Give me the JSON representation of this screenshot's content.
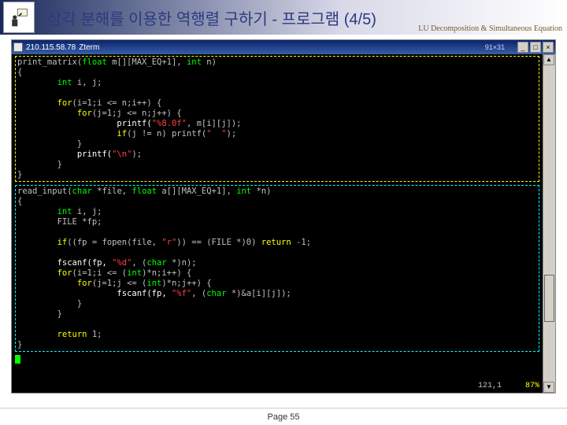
{
  "header": {
    "title": "삼각 분해를 이용한 역행렬 구하기 - 프로그램 (4/5)",
    "subtitle": "LU Decomposition & Simultaneous Equation"
  },
  "terminal": {
    "host": "210.115.58.78",
    "app": "Zterm",
    "dimensions": "91×31",
    "buttons": {
      "min": "_",
      "max": "□",
      "close": "×"
    },
    "scroll": {
      "up": "▲",
      "down": "▼"
    },
    "status": {
      "pos": "121,1",
      "pct": "87%"
    }
  },
  "code": {
    "block1": {
      "l1a": "print_matrix(",
      "l1b": "float",
      "l1c": " m[][MAX_EQ+1], ",
      "l1d": "int",
      "l1e": " n)",
      "l2": "{",
      "l3a": "        int",
      "l3b": " i, j;",
      "l4": " ",
      "l5a": "        for",
      "l5b": "(i=1;i <= n;i++) {",
      "l6a": "            for",
      "l6b": "(j=1;j <= n;j++) {",
      "l7a": "                    printf(",
      "l7b": "\"%8.0f\"",
      "l7c": ", m[i][j]);",
      "l8a": "                    if",
      "l8b": "(j != n) printf(",
      "l8c": "\"  \"",
      "l8d": ");",
      "l9": "            }",
      "l10a": "            printf(",
      "l10b": "\"\\n\"",
      "l10c": ");",
      "l11": "        }",
      "l12": "}"
    },
    "block2": {
      "l1a": "read_input(",
      "l1b": "char",
      "l1c": " *file, ",
      "l1d": "float",
      "l1e": " a[][MAX_EQ+1], ",
      "l1f": "int",
      "l1g": " *n)",
      "l2": "{",
      "l3a": "        int",
      "l3b": " i, j;",
      "l4": "        FILE *fp;",
      "l5": " ",
      "l6a": "        if",
      "l6b": "((fp = fopen(file, ",
      "l6c": "\"r\"",
      "l6d": ")) == (FILE *)0) ",
      "l6e": "return",
      "l6f": " -1;",
      "l7": " ",
      "l8a": "        fscanf(fp, ",
      "l8b": "\"%d\"",
      "l8c": ", (",
      "l8d": "char",
      "l8e": " *)n);",
      "l9a": "        for",
      "l9b": "(i=1;i <= (",
      "l9c": "int",
      "l9d": ")*n;i++) {",
      "l10a": "            for",
      "l10b": "(j=1;j <= (",
      "l10c": "int",
      "l10d": ")*n;j++) {",
      "l11a": "                    fscanf(fp, ",
      "l11b": "\"%f\"",
      "l11c": ", (",
      "l11d": "char",
      "l11e": " *)&a[i][j]);",
      "l12": "            }",
      "l13": "        }",
      "l14": " ",
      "l15a": "        return",
      "l15b": " 1;",
      "l16": "}"
    }
  },
  "footer": {
    "page": "Page 55"
  }
}
